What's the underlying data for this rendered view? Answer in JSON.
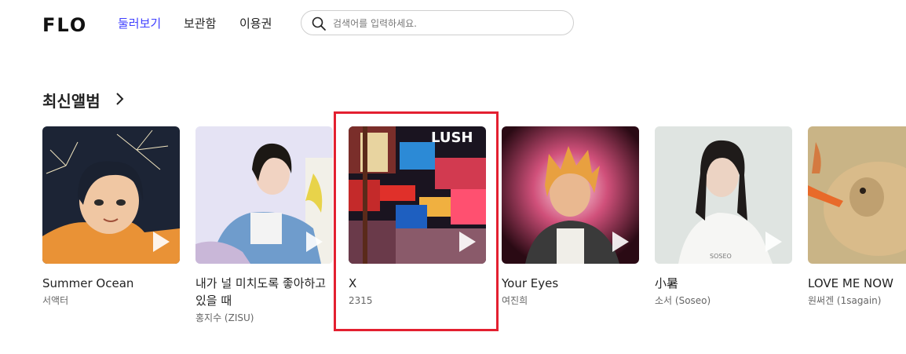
{
  "header": {
    "logo": "FLO",
    "nav": [
      "둘러보기",
      "보관함",
      "이용권"
    ],
    "search_placeholder": "검색어를 입력하세요."
  },
  "section": {
    "title": "최신앨범"
  },
  "albums": [
    {
      "title": "Summer Ocean",
      "artist": "서액터"
    },
    {
      "title": "내가 널 미치도록 좋아하고 있을 때",
      "artist": "홍지수 (ZISU)"
    },
    {
      "title": "X",
      "artist": "2315"
    },
    {
      "title": "Your Eyes",
      "artist": "여진희"
    },
    {
      "title": "小暑",
      "artist": "소서 (Soseo)"
    },
    {
      "title": "LOVE ME NOW",
      "artist": "원써겐 (1sagain)"
    }
  ],
  "cover_texts": {
    "lush": "LUSH",
    "soseo": "SOSEO"
  },
  "colors": {
    "accent": "#3f3fff",
    "highlight": "#e32030"
  }
}
